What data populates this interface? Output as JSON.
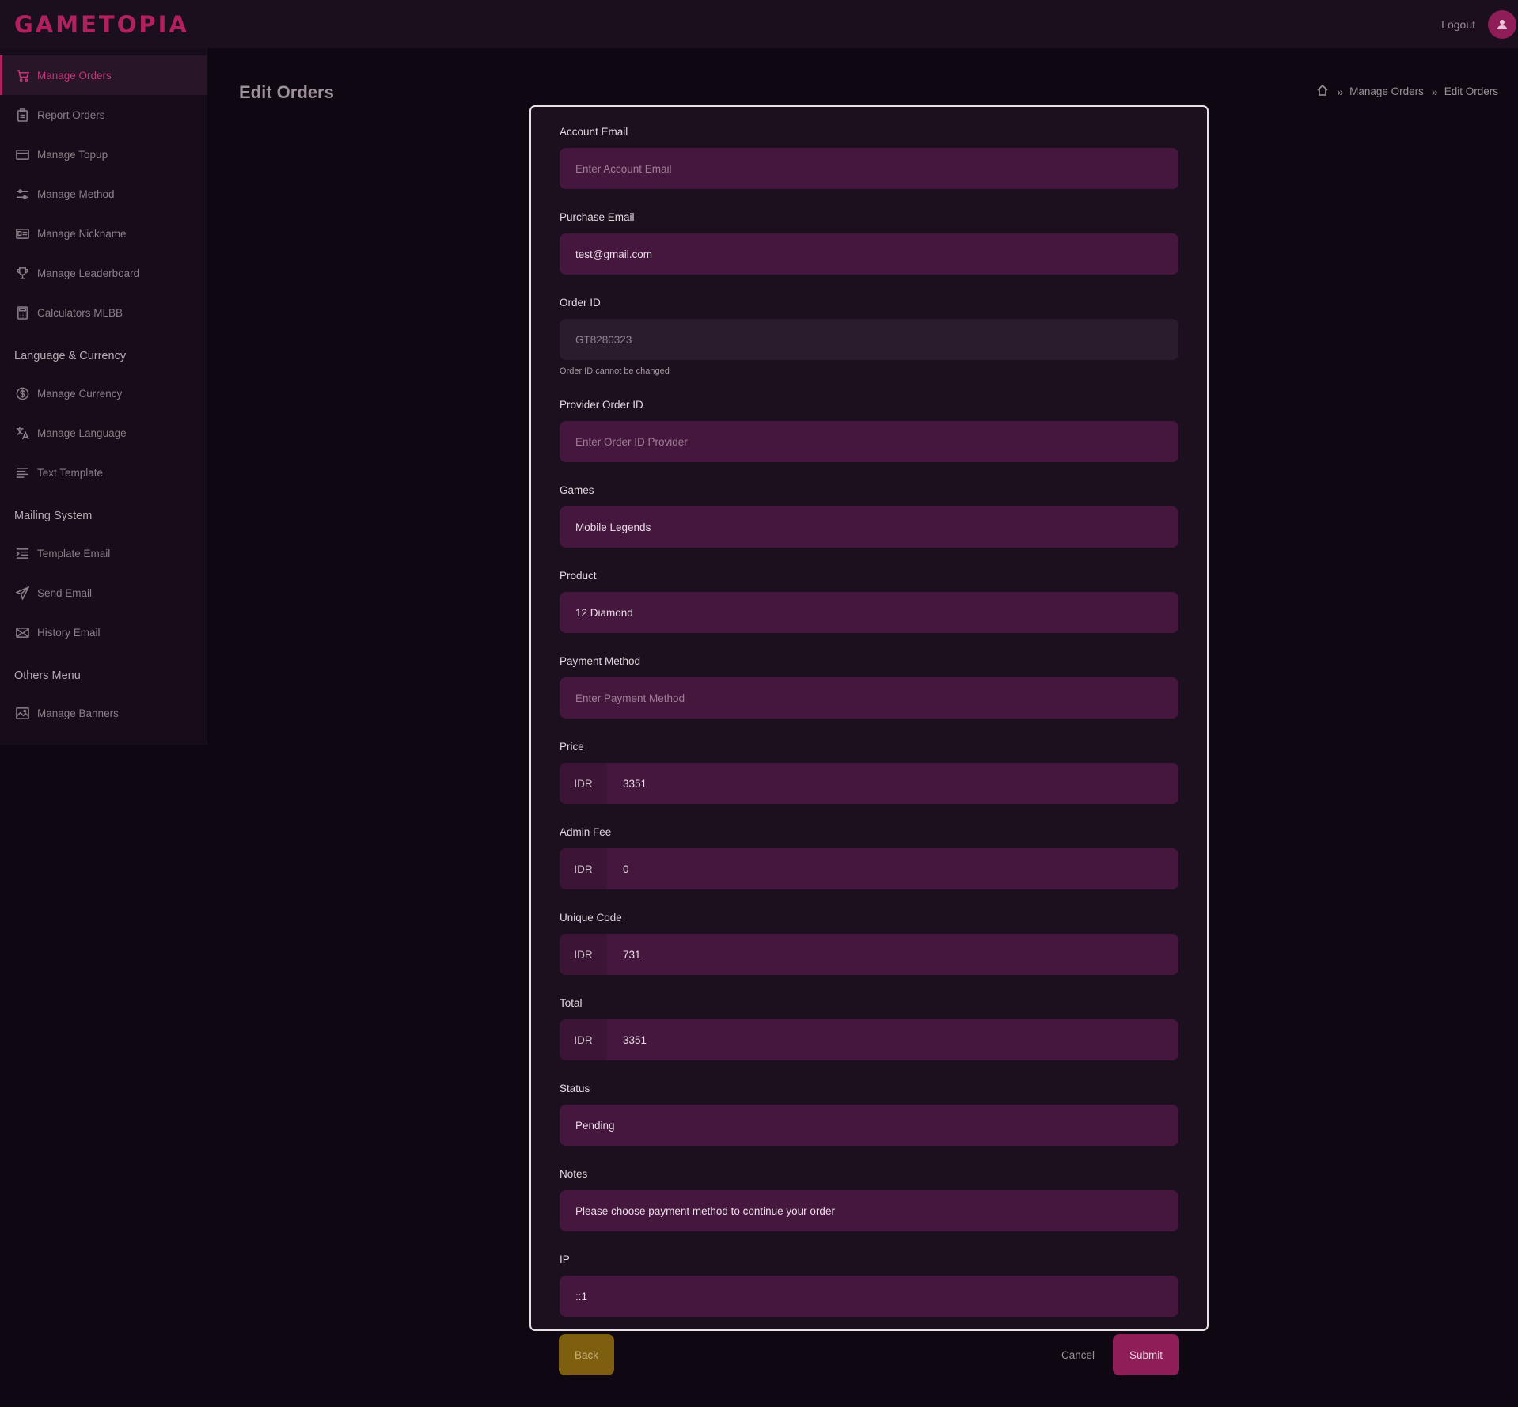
{
  "app": {
    "logo": "GAMETOPIA"
  },
  "header": {
    "logout_label": "Logout"
  },
  "sidebar": {
    "items": [
      {
        "label": "Manage Orders",
        "icon": "cart-icon"
      },
      {
        "label": "Report Orders",
        "icon": "clipboard-icon"
      },
      {
        "label": "Manage Topup",
        "icon": "card-icon"
      },
      {
        "label": "Manage Method",
        "icon": "sliders-icon"
      },
      {
        "label": "Manage Nickname",
        "icon": "id-card-icon"
      },
      {
        "label": "Manage Leaderboard",
        "icon": "trophy-icon"
      },
      {
        "label": "Calculators MLBB",
        "icon": "calculator-icon"
      }
    ],
    "section_language": "Language & Currency",
    "language_items": [
      {
        "label": "Manage Currency",
        "icon": "currency-icon"
      },
      {
        "label": "Manage Language",
        "icon": "translate-icon"
      },
      {
        "label": "Text Template",
        "icon": "text-lines-icon"
      }
    ],
    "section_mailing": "Mailing System",
    "mailing_items": [
      {
        "label": "Template Email",
        "icon": "list-indent-icon"
      },
      {
        "label": "Send Email",
        "icon": "send-icon"
      },
      {
        "label": "History Email",
        "icon": "mail-icon"
      }
    ],
    "section_others": "Others Menu",
    "others_items": [
      {
        "label": "Manage Banners",
        "icon": "image-icon"
      }
    ]
  },
  "page": {
    "title": "Edit Orders",
    "breadcrumb": [
      "Manage Orders",
      "Edit Orders"
    ]
  },
  "form": {
    "account_email": {
      "label": "Account Email",
      "placeholder": "Enter Account Email"
    },
    "purchase_email": {
      "label": "Purchase Email",
      "value": "test@gmail.com"
    },
    "order_id": {
      "label": "Order ID",
      "value": "GT8280323",
      "help": "Order ID cannot be changed"
    },
    "provider_order_id": {
      "label": "Provider Order ID",
      "placeholder": "Enter Order ID Provider"
    },
    "games": {
      "label": "Games",
      "value": "Mobile Legends"
    },
    "product": {
      "label": "Product",
      "value": "12 Diamond"
    },
    "payment_method": {
      "label": "Payment Method",
      "placeholder": "Enter Payment Method"
    },
    "price": {
      "label": "Price",
      "currency": "IDR",
      "value": "3351"
    },
    "admin_fee": {
      "label": "Admin Fee",
      "currency": "IDR",
      "value": "0"
    },
    "unique_code": {
      "label": "Unique Code",
      "currency": "IDR",
      "value": "731"
    },
    "total": {
      "label": "Total",
      "currency": "IDR",
      "value": "3351"
    },
    "status": {
      "label": "Status",
      "value": "Pending"
    },
    "notes": {
      "label": "Notes",
      "value": "Please choose payment method to continue your order"
    },
    "ip": {
      "label": "IP",
      "value": "::1"
    }
  },
  "actions": {
    "back": "Back",
    "cancel": "Cancel",
    "submit": "Submit"
  },
  "colors": {
    "accent": "#b3205f",
    "input_bg": "#45173e",
    "back_button": "#7d5f0f"
  }
}
